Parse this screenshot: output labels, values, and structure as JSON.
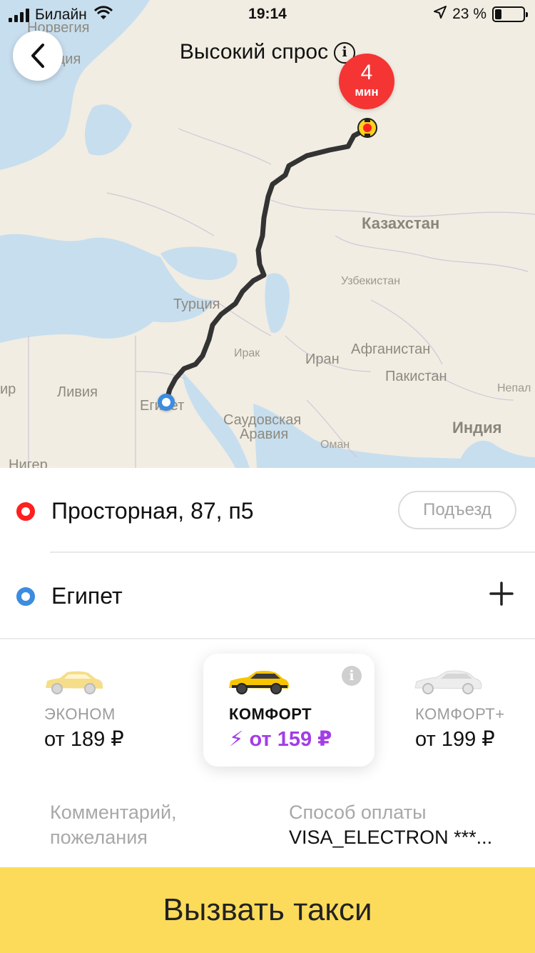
{
  "status_bar": {
    "carrier": "Билайн",
    "time": "19:14",
    "battery": "23 %",
    "battery_level": 0.23
  },
  "header": {
    "title": "Высокий спрос",
    "info_glyph": "i"
  },
  "eta": {
    "value": "4",
    "unit": "мин"
  },
  "map": {
    "labels": {
      "norway": "Норвегия",
      "sweden": "Швеция",
      "kazakhstan": "Казахстан",
      "uzbekistan": "Узбекистан",
      "turkey": "Турция",
      "iraq": "Ирак",
      "iran": "Иран",
      "afghanistan": "Афганистан",
      "pakistan": "Пакистан",
      "nepal": "Непал",
      "libya": "Ливия",
      "egypt": "Египет",
      "saudi_1": "Саудовская",
      "saudi_2": "Аравия",
      "oman": "Оман",
      "india": "Индия",
      "niger": "Нигер",
      "alzhir": "ир"
    }
  },
  "route": {
    "from": "Просторная, 87, п5",
    "to": "Египет",
    "entrance_label": "Подъезд"
  },
  "tariffs": [
    {
      "name": "ЭКОНОМ",
      "price": "от 189 ₽"
    },
    {
      "name": "КОМФОРТ",
      "price": "от 159 ₽",
      "lightning": "⚡"
    },
    {
      "name": "КОМФОРТ+",
      "price": "от 199 ₽"
    }
  ],
  "tariff_info_glyph": "i",
  "options": {
    "comment": "Комментарий, пожелания",
    "payment_label": "Способ оплаты",
    "payment_value": "VISA_ELECTRON ***..."
  },
  "call_button": "Вызвать такси",
  "colors": {
    "accent_yellow": "#fcdb5a",
    "surge_purple": "#a23ee6",
    "pin_red": "#ff1f1f",
    "pin_blue": "#3c8cdf",
    "eta_red": "#f53434"
  },
  "icons": {
    "back": "chevron-left-icon",
    "info": "info-icon",
    "add": "plus-icon",
    "location": "location-arrow-icon",
    "wifi": "wifi-icon"
  }
}
